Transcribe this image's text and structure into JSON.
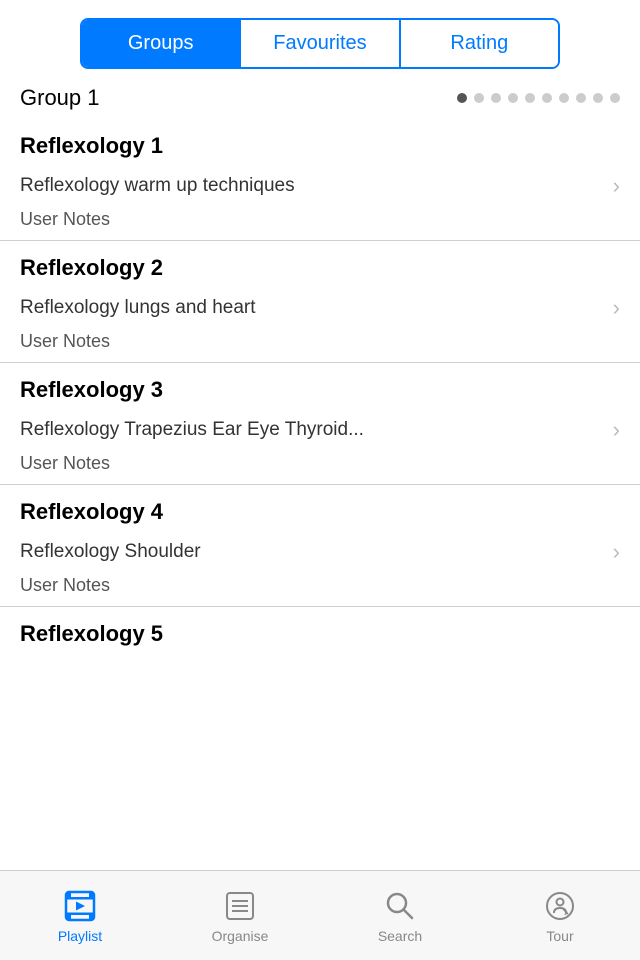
{
  "topTabs": {
    "tabs": [
      {
        "id": "groups",
        "label": "Groups",
        "active": true
      },
      {
        "id": "favourites",
        "label": "Favourites",
        "active": false
      },
      {
        "id": "rating",
        "label": "Rating",
        "active": false
      }
    ]
  },
  "groupHeader": {
    "title": "Group 1",
    "dots": [
      true,
      false,
      false,
      false,
      false,
      false,
      false,
      false,
      false,
      false
    ]
  },
  "sections": [
    {
      "id": "reflexology-1",
      "title": "Reflexology 1",
      "item": "Reflexology  warm up techniques",
      "userNotes": "User Notes",
      "hasChevron": true
    },
    {
      "id": "reflexology-2",
      "title": "Reflexology 2",
      "item": "Reflexology lungs and heart",
      "userNotes": "User Notes",
      "hasChevron": true
    },
    {
      "id": "reflexology-3",
      "title": "Reflexology 3",
      "item": "Reflexology Trapezius Ear Eye Thyroid...",
      "userNotes": "User Notes",
      "hasChevron": true
    },
    {
      "id": "reflexology-4",
      "title": "Reflexology 4",
      "item": "Reflexology Shoulder",
      "userNotes": "User Notes",
      "hasChevron": true
    },
    {
      "id": "reflexology-5",
      "title": "Reflexology 5",
      "item": "",
      "userNotes": "",
      "hasChevron": false
    }
  ],
  "bottomNav": {
    "items": [
      {
        "id": "playlist",
        "label": "Playlist",
        "active": true
      },
      {
        "id": "organise",
        "label": "Organise",
        "active": false
      },
      {
        "id": "search",
        "label": "Search",
        "active": false
      },
      {
        "id": "tour",
        "label": "Tour",
        "active": false
      }
    ]
  }
}
